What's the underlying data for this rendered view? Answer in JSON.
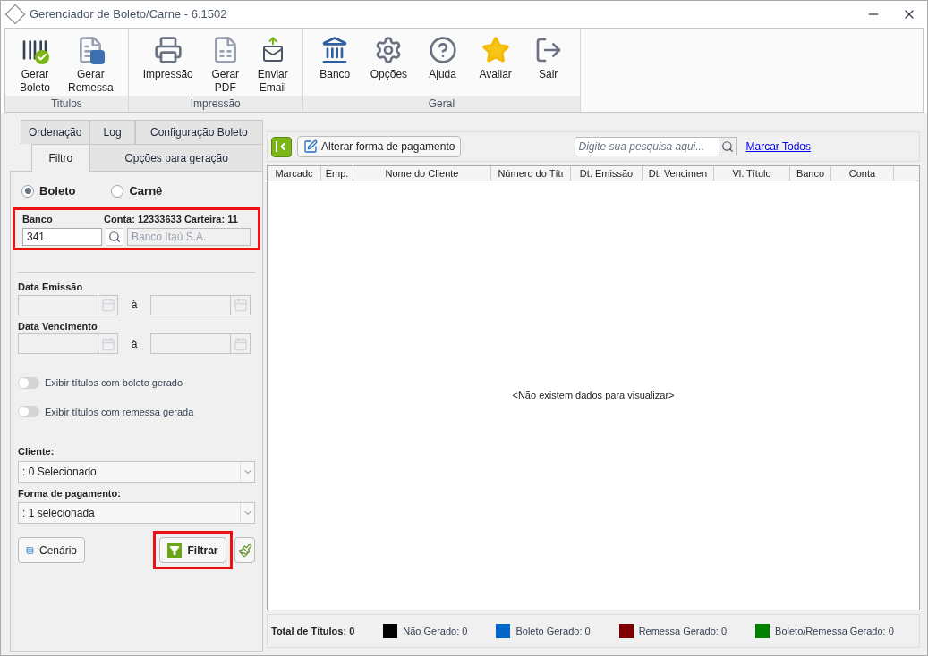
{
  "window": {
    "title": "Gerenciador de Boleto/Carne - 6.1502"
  },
  "ribbon": {
    "groups": [
      {
        "label": "Titulos",
        "buttons": [
          {
            "label": "Gerar\nBoleto"
          },
          {
            "label": "Gerar\nRemessa"
          }
        ]
      },
      {
        "label": "Impressão",
        "buttons": [
          {
            "label": "Impressão"
          },
          {
            "label": "Gerar\nPDF"
          },
          {
            "label": "Enviar\nEmail"
          }
        ]
      },
      {
        "label": "Geral",
        "buttons": [
          {
            "label": "Banco"
          },
          {
            "label": "Opções"
          },
          {
            "label": "Ajuda"
          },
          {
            "label": "Avaliar"
          },
          {
            "label": "Sair"
          }
        ]
      }
    ]
  },
  "left_panel": {
    "tab_rows": [
      [
        {
          "label": "Ordenação",
          "selected": false
        },
        {
          "label": "Log",
          "selected": false
        },
        {
          "label": "Configuração Boleto",
          "selected": false
        }
      ],
      [
        {
          "label": "Filtro",
          "selected": true
        },
        {
          "label": "Opções para geração",
          "selected": false
        }
      ]
    ],
    "document_type": [
      {
        "label": "Boleto",
        "selected": true
      },
      {
        "label": "Carnê",
        "selected": false
      }
    ],
    "bank": {
      "label": "Banco",
      "account_info": "Conta: 12333633 Carteira: 11",
      "code": "341",
      "name": "Banco Itaú S.A.",
      "highlighted": true
    },
    "date_ranges": [
      {
        "label": "Data Emissão",
        "separator": "à"
      },
      {
        "label": "Data Vencimento",
        "separator": "à"
      }
    ],
    "toggles": [
      {
        "label": "Exibir títulos com boleto gerado",
        "on": false
      },
      {
        "label": "Exibir títulos com remessa gerada",
        "on": false
      }
    ],
    "dropdowns": [
      {
        "label": "Cliente:",
        "value": ": 0 Selecionado"
      },
      {
        "label": "Forma de pagamento:",
        "value": ": 1 selecionada"
      }
    ],
    "scenario_button": "Cenário",
    "filter_button": {
      "label": "Filtrar",
      "highlighted": true
    }
  },
  "toolbar": {
    "change_payment_button": "Alterar forma de pagamento",
    "search": {
      "placeholder": "Digite sua pesquisa aqui..."
    },
    "mark_all_link": "Marcar Todos"
  },
  "table": {
    "columns": [
      "Marcadc",
      "Emp.",
      "Nome do Cliente",
      "Número do Títı",
      "Dt. Emissão",
      "Dt. Vencimen",
      "Vl. Título",
      "Banco",
      "Conta"
    ],
    "empty_message": "<Não existem dados para visualizar>"
  },
  "status_bar": {
    "total": "Total de Títulos: 0",
    "legend": [
      {
        "label": "Não Gerado: 0",
        "color": "#000000"
      },
      {
        "label": "Boleto Gerado: 0",
        "color": "#0066cc"
      },
      {
        "label": "Remessa Gerado: 0",
        "color": "#800000"
      },
      {
        "label": "Boleto/Remessa Gerado: 0",
        "color": "#008000"
      }
    ]
  }
}
